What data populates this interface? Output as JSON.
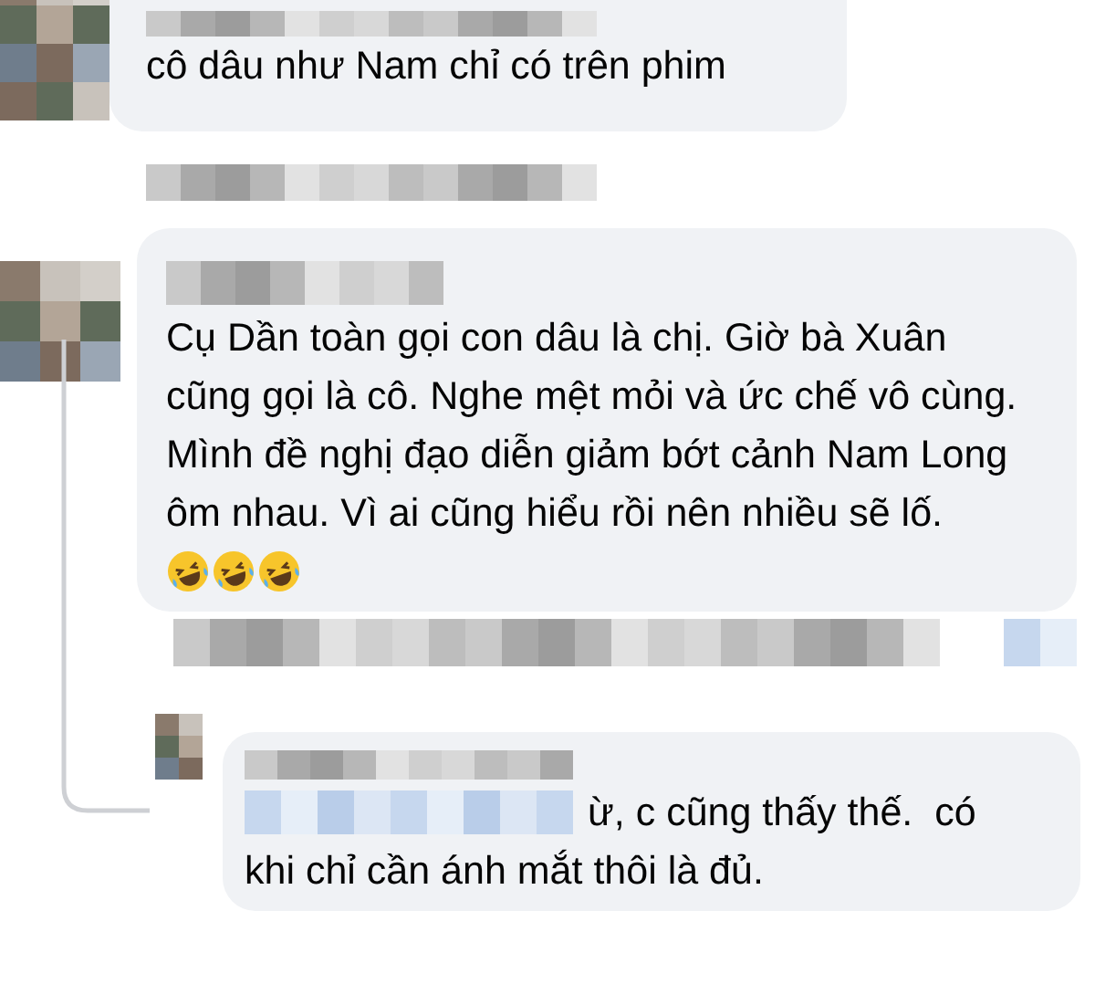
{
  "comments": [
    {
      "paragraphs": [
        "cô dâu như Nam chỉ có trên phim"
      ]
    },
    {
      "paragraphs": [
        "Cụ Dần toàn gọi con dâu là chị. Giờ bà Xuân cũng gọi là cô. Nghe mệt mỏi và ức chế vô cùng.",
        "Mình đề nghị đạo diễn giảm bớt cảnh Nam Long ôm nhau. Vì ai cũng hiểu rồi nên nhiều sẽ lố."
      ],
      "emojis": [
        {
          "kind": "laughing"
        },
        {
          "kind": "laughing"
        },
        {
          "kind": "laughing"
        }
      ],
      "replies": [
        {
          "paragraphs": [
            "ừ, c cũng thấy thế.  có",
            "khi chỉ cần ánh mắt thôi là đủ."
          ]
        }
      ]
    }
  ]
}
